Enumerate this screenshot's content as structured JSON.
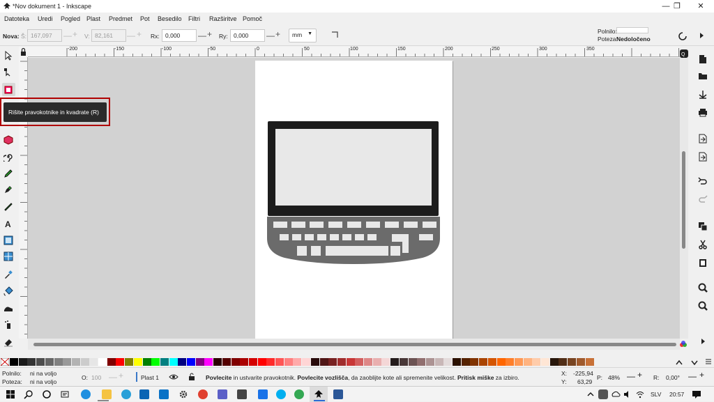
{
  "window": {
    "title": "*Nov dokument 1 - Inkscape",
    "minimize": "—",
    "restore": "❐",
    "close": "✕"
  },
  "menu": [
    "Datoteka",
    "Uredi",
    "Pogled",
    "Plast",
    "Predmet",
    "Pot",
    "Besedilo",
    "Filtri",
    "Razširitve",
    "Pomoč"
  ],
  "controls": {
    "mode_label": "Nova:",
    "w_label": "Š:",
    "w_value": "167,097",
    "h_label": "V:",
    "h_value": "82,161",
    "rx_label": "Rx:",
    "rx_value": "0,000",
    "ry_label": "Ry:",
    "ry_value": "0,000",
    "unit": "mm",
    "fill_label": "Polnilo:",
    "stroke_label": "Poteza:",
    "stroke_value": "Nedoločeno"
  },
  "ruler": {
    "h_ticks": [
      "-200",
      "-150",
      "-100",
      "-50",
      "0",
      "50",
      "100",
      "150",
      "200",
      "250",
      "300",
      "350"
    ],
    "v_ticks": [
      "0",
      "5",
      "1",
      "5",
      "2",
      "5",
      "3",
      "5",
      "4",
      "5"
    ]
  },
  "tooltip": "Rišite pravokotnike in kvadrate (R)",
  "status": {
    "fill_label": "Polnilo:",
    "fill_value": "ni na voljo",
    "stroke_label": "Poteza:",
    "stroke_value": "ni na voljo",
    "opacity_label": "O:",
    "opacity_value": "100",
    "layer": "Plast 1",
    "msg_b1": "Povlecite",
    "msg_1": " in ustvarite pravokotnik. ",
    "msg_b2": "Povlecite vozlišča",
    "msg_2": ", da zaoblijte kote ali spremenite velikost. ",
    "msg_b3": "Pritisk miške",
    "msg_3": " za izbiro.",
    "x_label": "X:",
    "x_value": "-225,94",
    "y_label": "Y:",
    "y_value": "63,29",
    "zoom_label": "P:",
    "zoom_value": "48%",
    "rot_label": "R:",
    "rot_value": "0,00°"
  },
  "taskbar": {
    "lang": "SLV",
    "time": "20:57"
  },
  "colors": {
    "tooltip_border": "#b00000",
    "laptop_frame": "#1c1c1c",
    "laptop_screen": "#e8e8e8",
    "laptop_base": "#6b6b6b"
  }
}
